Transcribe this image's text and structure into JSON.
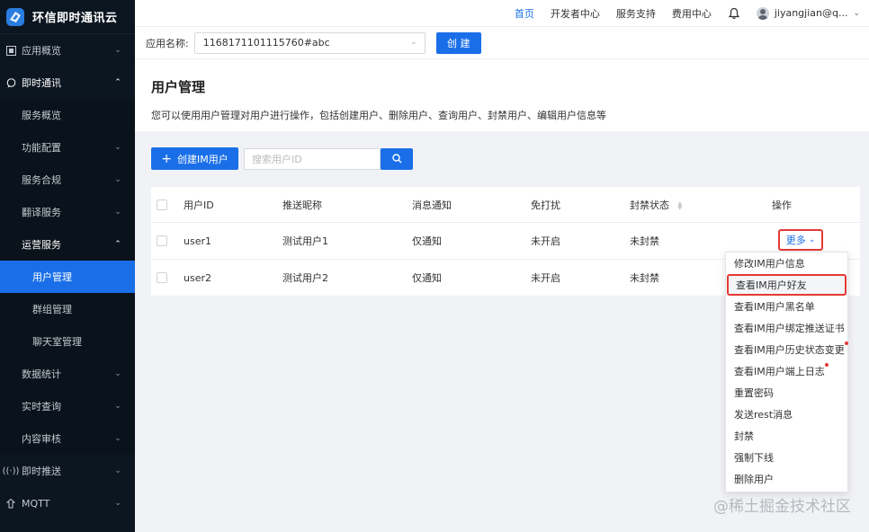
{
  "brand": {
    "name": "环信即时通讯云"
  },
  "topnav": {
    "links": [
      "首页",
      "开发者中心",
      "服务支持",
      "费用中心"
    ],
    "user": "jiyangjian@q..."
  },
  "appbar": {
    "label": "应用名称:",
    "app_value": "1168171101115760#abc",
    "create_label": "创 建"
  },
  "sidebar": {
    "items": [
      {
        "label": "应用概览"
      },
      {
        "label": "即时通讯"
      },
      {
        "label": "服务概览"
      },
      {
        "label": "功能配置"
      },
      {
        "label": "服务合规"
      },
      {
        "label": "翻译服务"
      },
      {
        "label": "运营服务"
      },
      {
        "label": "用户管理"
      },
      {
        "label": "群组管理"
      },
      {
        "label": "聊天室管理"
      },
      {
        "label": "数据统计"
      },
      {
        "label": "实时查询"
      },
      {
        "label": "内容审核"
      },
      {
        "label": "即时推送"
      },
      {
        "label": "MQTT"
      }
    ]
  },
  "page": {
    "title": "用户管理",
    "description": "您可以使用用户管理对用户进行操作，包括创建用户、删除用户、查询用户、封禁用户、编辑用户信息等",
    "add_label": "创建IM用户",
    "search_placeholder": "搜索用户ID"
  },
  "table": {
    "headers": [
      "用户ID",
      "推送昵称",
      "消息通知",
      "免打扰",
      "封禁状态",
      "操作"
    ],
    "rows": [
      [
        "user1",
        "测试用户1",
        "仅通知",
        "未开启",
        "未封禁"
      ],
      [
        "user2",
        "测试用户2",
        "仅通知",
        "未开启",
        "未封禁"
      ]
    ],
    "more_label": "更多"
  },
  "menu": {
    "items": [
      "修改IM用户信息",
      "查看IM用户好友",
      "查看IM用户黑名单",
      "查看IM用户绑定推送证书",
      "查看IM用户历史状态变更",
      "查看IM用户端上日志",
      "重置密码",
      "发送rest消息",
      "封禁",
      "强制下线",
      "删除用户"
    ]
  },
  "watermark": "@稀土掘金技术社区",
  "colors": {
    "accent": "#1a6fe8",
    "sidebar_bg": "#0c1621",
    "highlight": "#e53935"
  }
}
